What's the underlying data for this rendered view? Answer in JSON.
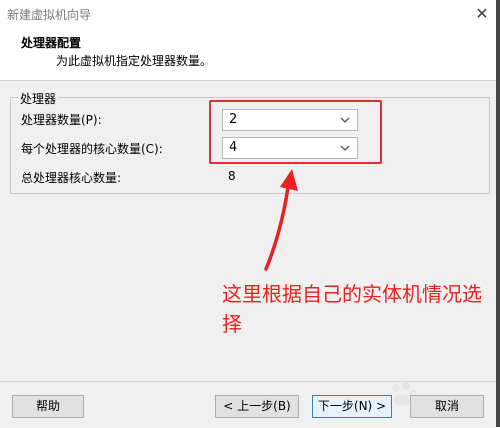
{
  "window": {
    "title": "新建虚拟机向导",
    "close_glyph": "✕"
  },
  "header": {
    "title": "处理器配置",
    "subtitle": "为此虚拟机指定处理器数量。"
  },
  "group": {
    "label": "处理器"
  },
  "fields": {
    "processors_label": "处理器数量(P):",
    "processors_value": "2",
    "cores_label": "每个处理器的核心数量(C):",
    "cores_value": "4",
    "total_label": "总处理器核心数量:",
    "total_value": "8"
  },
  "annotation": {
    "text": "这里根据自己的实体机情况选择",
    "color": "#e82222"
  },
  "buttons": {
    "help": "帮助",
    "back": "< 上一步(B)",
    "next": "下一步(N) >",
    "cancel": "取消"
  },
  "icons": {
    "chevron": "chevron-down-icon",
    "close": "close-icon",
    "arrow": "annotation-arrow-icon"
  }
}
